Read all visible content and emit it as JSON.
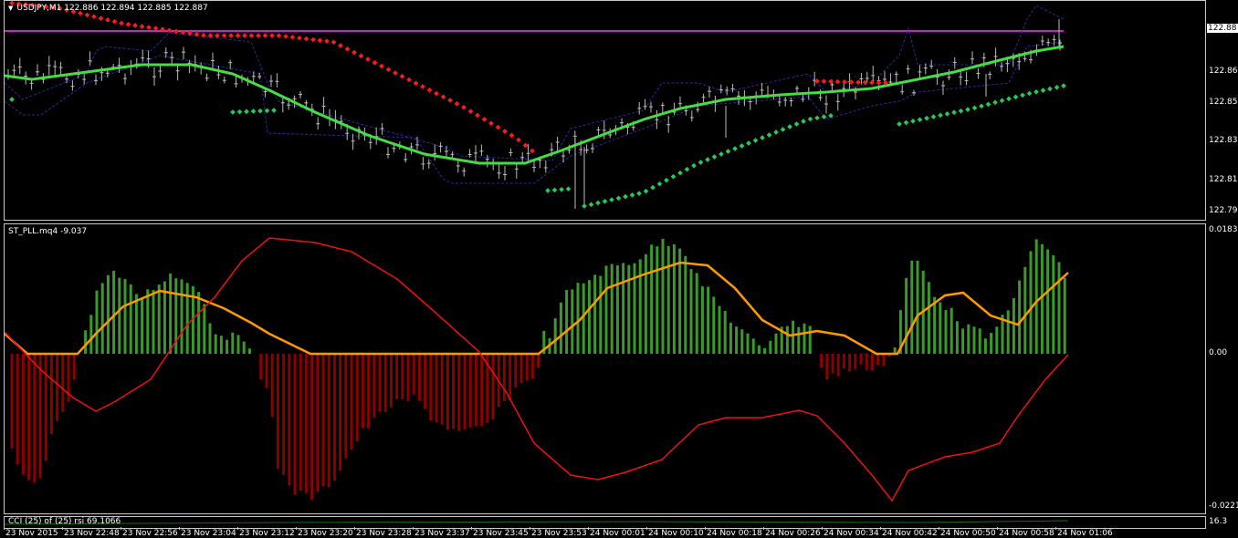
{
  "window": {
    "symbol_header": "USDJPY,M1",
    "ohlc": "122.886 122.894 122.885 122.887"
  },
  "main_axis": {
    "labels": [
      "122.88",
      "122.86",
      "122.85",
      "122.83",
      "122.81",
      "122.79"
    ],
    "current_price": "122.88"
  },
  "indicator": {
    "name": "ST_PLL.mq4 -9.037",
    "axis_labels": [
      "0.01839",
      "0.00",
      "-0.0221"
    ]
  },
  "cci": {
    "name": "CCI (25) of (25) rsi 69.1066",
    "axis_label": "16.3"
  },
  "time_axis": {
    "labels": [
      "23 Nov 2015",
      "23 Nov 22:48",
      "23 Nov 22:56",
      "23 Nov 23:04",
      "23 Nov 23:12",
      "23 Nov 23:20",
      "23 Nov 23:28",
      "23 Nov 23:37",
      "23 Nov 23:45",
      "23 Nov 23:53",
      "24 Nov 00:01",
      "24 Nov 00:10",
      "24 Nov 00:18",
      "24 Nov 00:26",
      "24 Nov 00:34",
      "24 Nov 00:42",
      "24 Nov 00:50",
      "24 Nov 00:58",
      "24 Nov 01:06"
    ]
  },
  "colors": {
    "background": "#000000",
    "grid": "#c8c8c8",
    "ma_line": "#44dd44",
    "magenta_level": "#cc22cc",
    "psar_up": "#ff1a1a",
    "psar_down": "#22cc55",
    "hist_pos": "#3a9a2a",
    "hist_neg": "#8b0000",
    "signal_line": "#ff9900",
    "red_line": "#ee1111",
    "channel": "#2a2a9a"
  }
}
